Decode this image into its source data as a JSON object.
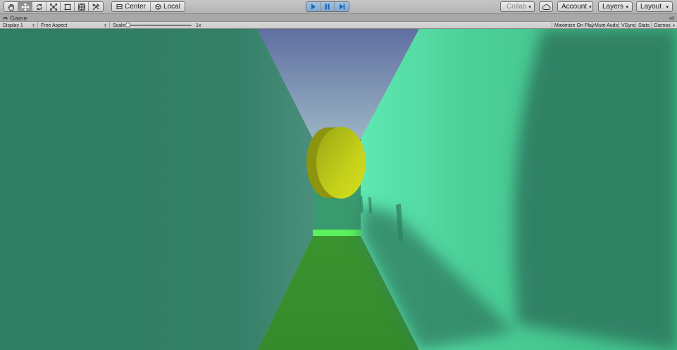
{
  "toolbar": {
    "tools": [
      {
        "name": "hand-tool",
        "icon": "hand-icon",
        "active": false
      },
      {
        "name": "move-tool",
        "icon": "move-icon",
        "active": true
      },
      {
        "name": "rotate-tool",
        "icon": "rotate-icon",
        "active": false
      },
      {
        "name": "scale-tool",
        "icon": "scale-icon",
        "active": false
      },
      {
        "name": "rect-tool",
        "icon": "rect-icon",
        "active": false
      },
      {
        "name": "transform-tool",
        "icon": "transform-icon",
        "active": false
      },
      {
        "name": "custom-tool",
        "icon": "custom-tools-icon",
        "active": false
      }
    ],
    "pivot": {
      "center_label": "Center",
      "local_label": "Local"
    },
    "playback": {
      "play_active": true,
      "pause_active": true,
      "step_active": true
    },
    "collab_label": "Collab",
    "account_label": "Account",
    "layers_label": "Layers",
    "layout_label": "Layout"
  },
  "game_tab": {
    "title": "Game"
  },
  "game_controls": {
    "display": "Display 1",
    "aspect": "Free Aspect",
    "scale_label": "Scale",
    "scale_value": "1x",
    "toggles": {
      "maximize": "Maximize On Play",
      "mute": "Mute Audio",
      "vsync": "VSync",
      "stats": "Stats",
      "gizmos": "Gizmos"
    }
  },
  "scene": {
    "colors": {
      "sky_top": "#5f6fa0",
      "sky_bottom": "#8fa6c0",
      "left_wall": "#2e7e63",
      "right_wall": "#45c892",
      "right_wall_light": "#5fe3ad",
      "floor": "#3a942f",
      "far_floor_strip": "#5cf25c",
      "coin_face": "#c8d41a",
      "coin_edge": "#8c9410"
    }
  }
}
